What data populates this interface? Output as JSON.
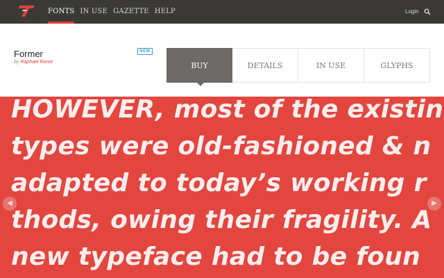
{
  "nav": {
    "items": [
      {
        "label": "Fonts",
        "active": true
      },
      {
        "label": "In Use",
        "active": false
      },
      {
        "label": "Gazette",
        "active": false
      },
      {
        "label": "Help",
        "active": false
      }
    ],
    "login": "Login"
  },
  "font": {
    "name": "Former",
    "by": "by",
    "author": "Raphaël Ronot",
    "badge": "NEW"
  },
  "tabs": [
    {
      "label": "Buy",
      "active": true
    },
    {
      "label": "Details",
      "active": false
    },
    {
      "label": "In Use",
      "active": false
    },
    {
      "label": "Glyphs",
      "active": false
    }
  ],
  "specimen": {
    "lines": [
      "HOWEVER, most of the existin",
      "types were old-fashioned & n",
      "adapted to today’s working r",
      "thods, owing their fragility. A",
      "new typeface had to be foun"
    ]
  },
  "colors": {
    "accent": "#e0413a",
    "topbar": "#3a3936",
    "specimen_bg": "#e2463f",
    "badge": "#3c9cc8"
  },
  "icons": {
    "logo": "foundry-logo-icon",
    "search": "search-icon",
    "prev": "chevron-left-icon",
    "next": "chevron-right-icon"
  }
}
